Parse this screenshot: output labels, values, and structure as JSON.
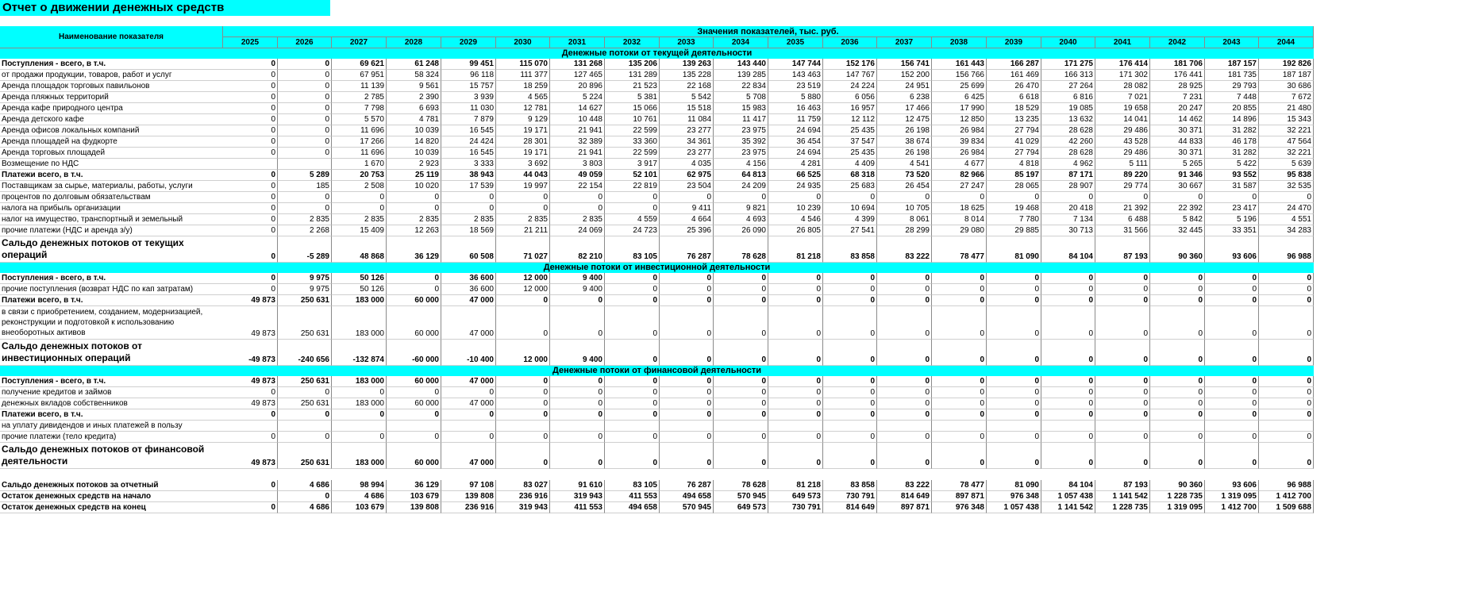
{
  "title": "Отчет о движении денежных средств",
  "header": {
    "name_col": "Наименование показателя",
    "values_label": "Значения показателей, тыс. руб.",
    "years": [
      "2025",
      "2026",
      "2027",
      "2028",
      "2029",
      "2030",
      "2031",
      "2032",
      "2033",
      "2034",
      "2035",
      "2036",
      "2037",
      "2038",
      "2039",
      "2040",
      "2041",
      "2042",
      "2043",
      "2044"
    ]
  },
  "sections": [
    {
      "title": "Денежные потоки от текущей деятельности",
      "rows": [
        {
          "label": "Поступления - всего, в т.ч.",
          "bold": true,
          "values": [
            "0",
            "0",
            "69 621",
            "61 248",
            "99 451",
            "115 070",
            "131 268",
            "135 206",
            "139 263",
            "143 440",
            "147 744",
            "152 176",
            "156 741",
            "161 443",
            "166 287",
            "171 275",
            "176 414",
            "181 706",
            "187 157",
            "192 826"
          ]
        },
        {
          "label": "от продажи продукции, товаров, работ и услуг",
          "values": [
            "0",
            "0",
            "67 951",
            "58 324",
            "96 118",
            "111 377",
            "127 465",
            "131 289",
            "135 228",
            "139 285",
            "143 463",
            "147 767",
            "152 200",
            "156 766",
            "161 469",
            "166 313",
            "171 302",
            "176 441",
            "181 735",
            "187 187"
          ]
        },
        {
          "label": "Аренда площадок торговых павильонов",
          "values": [
            "0",
            "0",
            "11 139",
            "9 561",
            "15 757",
            "18 259",
            "20 896",
            "21 523",
            "22 168",
            "22 834",
            "23 519",
            "24 224",
            "24 951",
            "25 699",
            "26 470",
            "27 264",
            "28 082",
            "28 925",
            "29 793",
            "30 686"
          ]
        },
        {
          "label": "Аренда пляжных территорий",
          "values": [
            "0",
            "0",
            "2 785",
            "2 390",
            "3 939",
            "4 565",
            "5 224",
            "5 381",
            "5 542",
            "5 708",
            "5 880",
            "6 056",
            "6 238",
            "6 425",
            "6 618",
            "6 816",
            "7 021",
            "7 231",
            "7 448",
            "7 672"
          ]
        },
        {
          "label": "Аренда кафе природного центра",
          "values": [
            "0",
            "0",
            "7 798",
            "6 693",
            "11 030",
            "12 781",
            "14 627",
            "15 066",
            "15 518",
            "15 983",
            "16 463",
            "16 957",
            "17 466",
            "17 990",
            "18 529",
            "19 085",
            "19 658",
            "20 247",
            "20 855",
            "21 480"
          ]
        },
        {
          "label": "Аренда детского кафе",
          "values": [
            "0",
            "0",
            "5 570",
            "4 781",
            "7 879",
            "9 129",
            "10 448",
            "10 761",
            "11 084",
            "11 417",
            "11 759",
            "12 112",
            "12 475",
            "12 850",
            "13 235",
            "13 632",
            "14 041",
            "14 462",
            "14 896",
            "15 343"
          ]
        },
        {
          "label": "Аренда офисов локальных компаний",
          "values": [
            "0",
            "0",
            "11 696",
            "10 039",
            "16 545",
            "19 171",
            "21 941",
            "22 599",
            "23 277",
            "23 975",
            "24 694",
            "25 435",
            "26 198",
            "26 984",
            "27 794",
            "28 628",
            "29 486",
            "30 371",
            "31 282",
            "32 221"
          ]
        },
        {
          "label": "Аренда площадей на фудкорте",
          "values": [
            "0",
            "0",
            "17 266",
            "14 820",
            "24 424",
            "28 301",
            "32 389",
            "33 360",
            "34 361",
            "35 392",
            "36 454",
            "37 547",
            "38 674",
            "39 834",
            "41 029",
            "42 260",
            "43 528",
            "44 833",
            "46 178",
            "47 564"
          ]
        },
        {
          "label": "Аренда торговых площадей",
          "values": [
            "0",
            "0",
            "11 696",
            "10 039",
            "16 545",
            "19 171",
            "21 941",
            "22 599",
            "23 277",
            "23 975",
            "24 694",
            "25 435",
            "26 198",
            "26 984",
            "27 794",
            "28 628",
            "29 486",
            "30 371",
            "31 282",
            "32 221"
          ]
        },
        {
          "label": "Возмещение по НДС",
          "values": [
            "",
            "",
            "1 670",
            "2 923",
            "3 333",
            "3 692",
            "3 803",
            "3 917",
            "4 035",
            "4 156",
            "4 281",
            "4 409",
            "4 541",
            "4 677",
            "4 818",
            "4 962",
            "5 111",
            "5 265",
            "5 422",
            "5 639"
          ]
        },
        {
          "label": "Платежи всего, в т.ч.",
          "bold": true,
          "values": [
            "0",
            "5 289",
            "20 753",
            "25 119",
            "38 943",
            "44 043",
            "49 059",
            "52 101",
            "62 975",
            "64 813",
            "66 525",
            "68 318",
            "73 520",
            "82 966",
            "85 197",
            "87 171",
            "89 220",
            "91 346",
            "93 552",
            "95 838"
          ]
        },
        {
          "label": "Поставщикам за сырье, материалы, работы, услуги",
          "values": [
            "0",
            "185",
            "2 508",
            "10 020",
            "17 539",
            "19 997",
            "22 154",
            "22 819",
            "23 504",
            "24 209",
            "24 935",
            "25 683",
            "26 454",
            "27 247",
            "28 065",
            "28 907",
            "29 774",
            "30 667",
            "31 587",
            "32 535"
          ]
        },
        {
          "label": "процентов по долговым обязательствам",
          "values": [
            "0",
            "0",
            "0",
            "0",
            "0",
            "0",
            "0",
            "0",
            "0",
            "0",
            "0",
            "0",
            "0",
            "0",
            "0",
            "0",
            "0",
            "0",
            "0",
            "0"
          ]
        },
        {
          "label": "налога на прибыль организации",
          "values": [
            "0",
            "0",
            "0",
            "0",
            "0",
            "0",
            "0",
            "0",
            "9 411",
            "9 821",
            "10 239",
            "10 694",
            "10 705",
            "18 625",
            "19 468",
            "20 418",
            "21 392",
            "22 392",
            "23 417",
            "24 470"
          ]
        },
        {
          "label": "налог на имущество, транспортный и земельный",
          "values": [
            "0",
            "2 835",
            "2 835",
            "2 835",
            "2 835",
            "2 835",
            "2 835",
            "4 559",
            "4 664",
            "4 693",
            "4 546",
            "4 399",
            "8 061",
            "8 014",
            "7 780",
            "7 134",
            "6 488",
            "5 842",
            "5 196",
            "4 551"
          ]
        },
        {
          "label": "прочие платежи (НДС и аренда з/у)",
          "values": [
            "0",
            "2 268",
            "15 409",
            "12 263",
            "18 569",
            "21 211",
            "24 069",
            "24 723",
            "25 396",
            "26 090",
            "26 805",
            "27 541",
            "28 299",
            "29 080",
            "29 885",
            "30 713",
            "31 566",
            "32 445",
            "33 351",
            "34 283"
          ]
        },
        {
          "label": "Сальдо денежных потоков от текущих операций",
          "big": true,
          "values": [
            "0",
            "-5 289",
            "48 868",
            "36 129",
            "60 508",
            "71 027",
            "82 210",
            "83 105",
            "76 287",
            "78 628",
            "81 218",
            "83 858",
            "83 222",
            "78 477",
            "81 090",
            "84 104",
            "87 193",
            "90 360",
            "93 606",
            "96 988"
          ]
        }
      ]
    },
    {
      "title": "Денежные потоки от инвестиционной деятельности",
      "rows": [
        {
          "label": "Поступления - всего, в т.ч.",
          "bold": true,
          "values": [
            "0",
            "9 975",
            "50 126",
            "0",
            "36 600",
            "12 000",
            "9 400",
            "0",
            "0",
            "0",
            "0",
            "0",
            "0",
            "0",
            "0",
            "0",
            "0",
            "0",
            "0",
            "0"
          ]
        },
        {
          "label": "прочие поступления (возврат НДС по кап затратам)",
          "values": [
            "0",
            "9 975",
            "50 126",
            "0",
            "36 600",
            "12 000",
            "9 400",
            "0",
            "0",
            "0",
            "0",
            "0",
            "0",
            "0",
            "0",
            "0",
            "0",
            "0",
            "0",
            "0"
          ]
        },
        {
          "label": "Платежи всего, в т.ч.",
          "bold": true,
          "values": [
            "49 873",
            "250 631",
            "183 000",
            "60 000",
            "47 000",
            "0",
            "0",
            "0",
            "0",
            "0",
            "0",
            "0",
            "0",
            "0",
            "0",
            "0",
            "0",
            "0",
            "0",
            "0"
          ]
        },
        {
          "label": "в связи с приобретением, созданием, модернизацией, реконструкции и подготовкой к использованию внеоборотных активов",
          "wrap3": true,
          "values": [
            "49 873",
            "250 631",
            "183 000",
            "60 000",
            "47 000",
            "0",
            "0",
            "0",
            "0",
            "0",
            "0",
            "0",
            "0",
            "0",
            "0",
            "0",
            "0",
            "0",
            "0",
            "0"
          ]
        },
        {
          "label": "Сальдо денежных потоков от инвестиционных операций",
          "big": true,
          "values": [
            "-49 873",
            "-240 656",
            "-132 874",
            "-60 000",
            "-10 400",
            "12 000",
            "9 400",
            "0",
            "0",
            "0",
            "0",
            "0",
            "0",
            "0",
            "0",
            "0",
            "0",
            "0",
            "0",
            "0"
          ]
        }
      ]
    },
    {
      "title": "Денежные потоки от финансовой деятельности",
      "rows": [
        {
          "label": "Поступления - всего, в т.ч.",
          "bold": true,
          "values": [
            "49 873",
            "250 631",
            "183 000",
            "60 000",
            "47 000",
            "0",
            "0",
            "0",
            "0",
            "0",
            "0",
            "0",
            "0",
            "0",
            "0",
            "0",
            "0",
            "0",
            "0",
            "0"
          ]
        },
        {
          "label": "получение кредитов и займов",
          "values": [
            "0",
            "0",
            "0",
            "0",
            "0",
            "0",
            "0",
            "0",
            "0",
            "0",
            "0",
            "0",
            "0",
            "0",
            "0",
            "0",
            "0",
            "0",
            "0",
            "0"
          ]
        },
        {
          "label": "денежных вкладов собственников",
          "values": [
            "49 873",
            "250 631",
            "183 000",
            "60 000",
            "47 000",
            "0",
            "0",
            "0",
            "0",
            "0",
            "0",
            "0",
            "0",
            "0",
            "0",
            "0",
            "0",
            "0",
            "0",
            "0"
          ]
        },
        {
          "label": "Платежи всего, в т.ч.",
          "bold": true,
          "values": [
            "0",
            "0",
            "0",
            "0",
            "0",
            "0",
            "0",
            "0",
            "0",
            "0",
            "0",
            "0",
            "0",
            "0",
            "0",
            "0",
            "0",
            "0",
            "0",
            "0"
          ]
        },
        {
          "label": "на уплату дивидендов и иных платежей в пользу",
          "values": [
            "",
            "",
            "",
            "",
            "",
            "",
            "",
            "",
            "",
            "",
            "",
            "",
            "",
            "",
            "",
            "",
            "",
            "",
            "",
            ""
          ]
        },
        {
          "label": "прочие платежи (тело кредита)",
          "values": [
            "0",
            "0",
            "0",
            "0",
            "0",
            "0",
            "0",
            "0",
            "0",
            "0",
            "0",
            "0",
            "0",
            "0",
            "0",
            "0",
            "0",
            "0",
            "0",
            "0"
          ]
        },
        {
          "label": "Сальдо денежных потоков от финансовой деятельности",
          "big": true,
          "values": [
            "49 873",
            "250 631",
            "183 000",
            "60 000",
            "47 000",
            "0",
            "0",
            "0",
            "0",
            "0",
            "0",
            "0",
            "0",
            "0",
            "0",
            "0",
            "0",
            "0",
            "0",
            "0"
          ]
        }
      ]
    }
  ],
  "totals": [
    {
      "label": "Сальдо денежных потоков за отчетный",
      "values": [
        "0",
        "4 686",
        "98 994",
        "36 129",
        "97 108",
        "83 027",
        "91 610",
        "83 105",
        "76 287",
        "78 628",
        "81 218",
        "83 858",
        "83 222",
        "78 477",
        "81 090",
        "84 104",
        "87 193",
        "90 360",
        "93 606",
        "96 988"
      ]
    },
    {
      "label": "Остаток денежных средств на начало",
      "values": [
        "",
        "0",
        "4 686",
        "103 679",
        "139 808",
        "236 916",
        "319 943",
        "411 553",
        "494 658",
        "570 945",
        "649 573",
        "730 791",
        "814 649",
        "897 871",
        "976 348",
        "1 057 438",
        "1 141 542",
        "1 228 735",
        "1 319 095",
        "1 412 700"
      ]
    },
    {
      "label": "Остаток денежных средств на конец",
      "values": [
        "0",
        "4 686",
        "103 679",
        "139 808",
        "236 916",
        "319 943",
        "411 553",
        "494 658",
        "570 945",
        "649 573",
        "730 791",
        "814 649",
        "897 871",
        "976 348",
        "1 057 438",
        "1 141 542",
        "1 228 735",
        "1 319 095",
        "1 412 700",
        "1 509 688"
      ]
    }
  ]
}
